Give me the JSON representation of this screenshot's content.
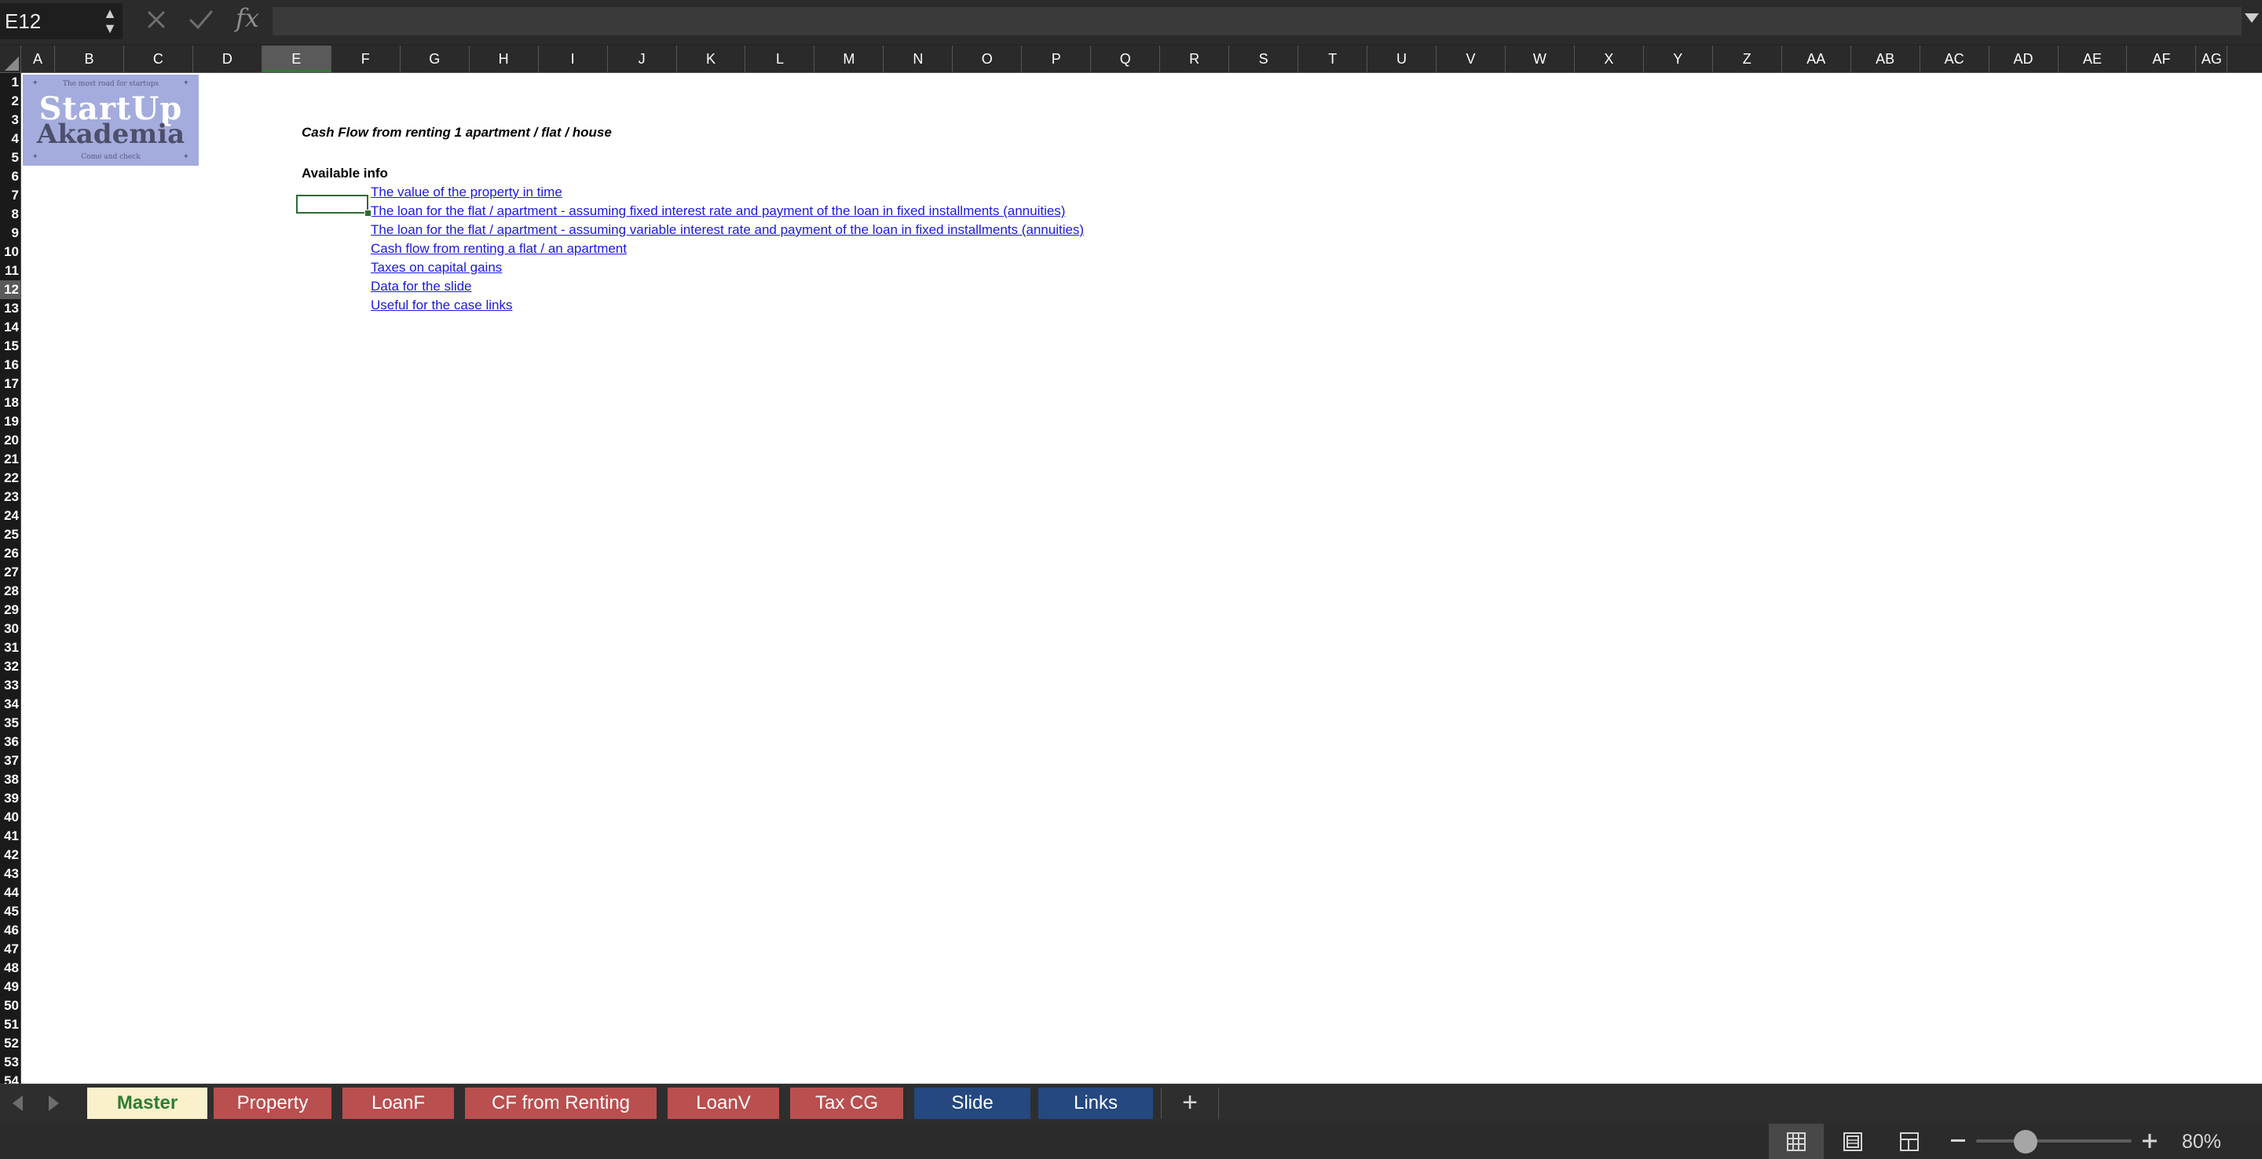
{
  "formula_bar": {
    "name_box": "E12",
    "fx_label": "fx",
    "formula_value": ""
  },
  "grid": {
    "columns": [
      "A",
      "B",
      "C",
      "D",
      "E",
      "F",
      "G",
      "H",
      "I",
      "J",
      "K",
      "L",
      "M",
      "N",
      "O",
      "P",
      "Q",
      "R",
      "S",
      "T",
      "U",
      "V",
      "W",
      "X",
      "Y",
      "Z",
      "AA",
      "AB",
      "AC",
      "AD",
      "AE",
      "AF"
    ],
    "row_count": 53,
    "selected_column": "E",
    "selected_row": 12
  },
  "logo": {
    "tagline": "The most road for startups",
    "title_line1": "StartUp",
    "title_line2": "Akademia",
    "subline": "Come and check"
  },
  "sheet": {
    "title": "Cash Flow from renting 1 apartment / flat / house",
    "available_label": "Available info",
    "links": [
      "The value of the property in time",
      "The loan for the flat / apartment - assuming fixed interest rate and payment of the loan in fixed installments (annuities)",
      "The loan for the flat / apartment - assuming variable interest rate and payment of the loan in fixed installments (annuities)",
      "Cash flow from renting a flat / an apartment",
      "Taxes on capital gains",
      "Data for the slide",
      "Useful for the case links"
    ]
  },
  "tabs": [
    {
      "label": "Master",
      "color": "#fbf0cc",
      "active": true
    },
    {
      "label": "Property",
      "color": "#b94f4f"
    },
    {
      "label": "LoanF",
      "color": "#b94f4f"
    },
    {
      "label": "CF from Renting",
      "color": "#b94f4f"
    },
    {
      "label": "LoanV",
      "color": "#b94f4f"
    },
    {
      "label": "Tax CG",
      "color": "#b94f4f"
    },
    {
      "label": "Slide",
      "color": "#24487f"
    },
    {
      "label": "Links",
      "color": "#24487f"
    }
  ],
  "add_sheet_label": "+",
  "status_bar": {
    "zoom": "80%",
    "zoom_fraction": 0.32
  }
}
